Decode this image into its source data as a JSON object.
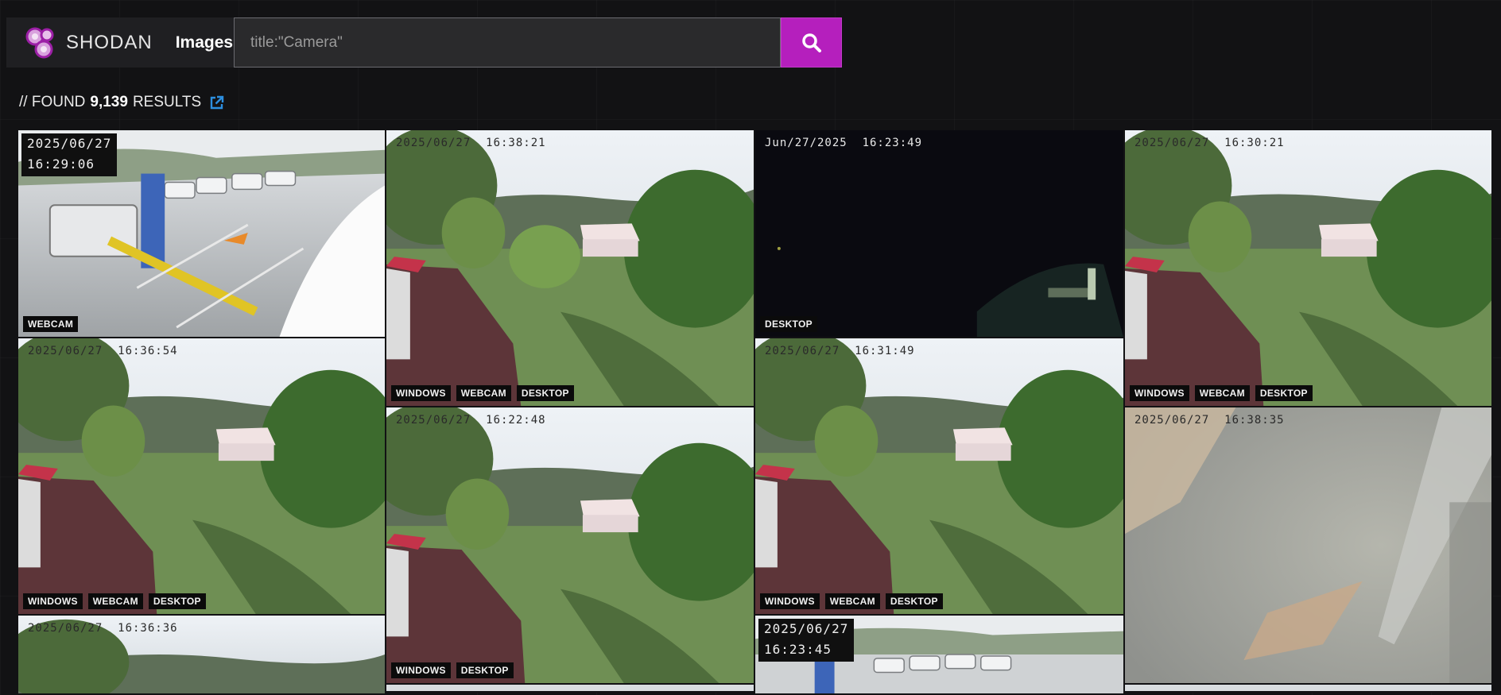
{
  "brand": {
    "name": "SHODAN",
    "section": "Images"
  },
  "search": {
    "placeholder": "title:\"Camera\"",
    "value": ""
  },
  "colors": {
    "accent": "#b51fbd",
    "link": "#2d8fe0"
  },
  "results": {
    "prefix": "// FOUND",
    "count": "9,139",
    "suffix": "RESULTS"
  },
  "tiles": [
    {
      "stamp": [
        "2025/06/27",
        "16:29:06"
      ],
      "tags": [
        "WEBCAM"
      ]
    },
    {
      "stamp": "2025/06/27  16:38:21",
      "tags": [
        "WINDOWS",
        "WEBCAM",
        "DESKTOP"
      ]
    },
    {
      "stamp": "Jun/27/2025  16:23:49",
      "tags": [
        "DESKTOP"
      ]
    },
    {
      "stamp": "2025/06/27  16:30:21",
      "tags": [
        "WINDOWS",
        "WEBCAM",
        "DESKTOP"
      ]
    },
    {
      "stamp": "2025/06/27  16:36:54",
      "tags": [
        "WINDOWS",
        "WEBCAM",
        "DESKTOP"
      ]
    },
    {
      "stamp": "2025/06/27  16:22:48",
      "tags": [
        "WINDOWS",
        "DESKTOP"
      ]
    },
    {
      "stamp": "2025/06/27  16:31:49",
      "tags": [
        "WINDOWS",
        "WEBCAM",
        "DESKTOP"
      ]
    },
    {
      "stamp": "2025/06/27  16:38:35",
      "tags": []
    },
    {
      "stamp": "2025/06/27  16:36:36",
      "tags": []
    },
    {
      "stamp": [
        "2025/06/27",
        "16:23:45"
      ],
      "tags": []
    }
  ]
}
